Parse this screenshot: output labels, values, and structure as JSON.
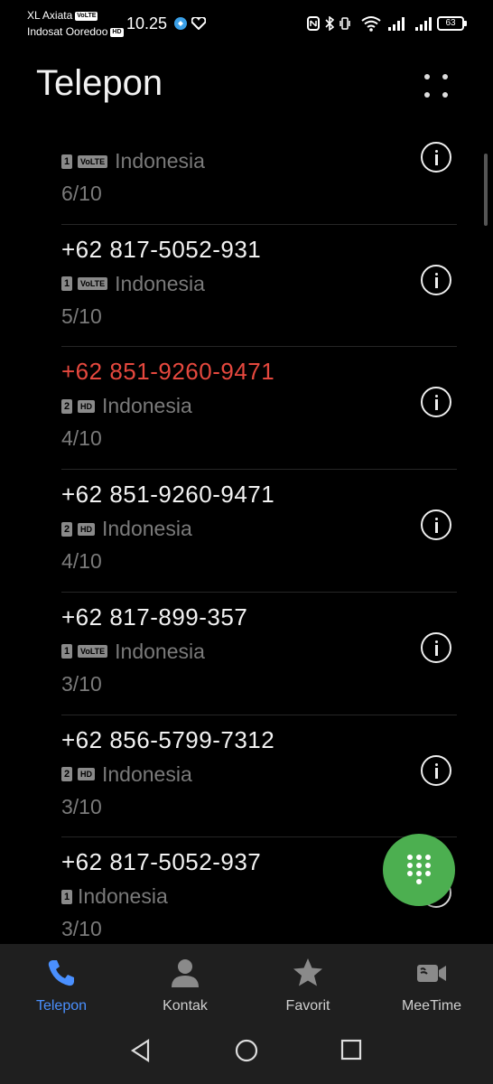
{
  "status_bar": {
    "carrier1": "XL Axiata",
    "carrier1_tag": "VoLTE",
    "carrier2": "Indosat Ooredoo",
    "carrier2_tag": "HD",
    "time": "10.25",
    "battery": "63"
  },
  "header": {
    "title": "Telepon"
  },
  "calls": [
    {
      "number": "",
      "sim": "1",
      "network": "VoLTE",
      "country": "Indonesia",
      "date": "6/10",
      "missed": false
    },
    {
      "number": "+62 817-5052-931",
      "sim": "1",
      "network": "VoLTE",
      "country": "Indonesia",
      "date": "5/10",
      "missed": false
    },
    {
      "number": "+62 851-9260-9471",
      "sim": "2",
      "network": "HD",
      "country": "Indonesia",
      "date": "4/10",
      "missed": true
    },
    {
      "number": "+62 851-9260-9471",
      "sim": "2",
      "network": "HD",
      "country": "Indonesia",
      "date": "4/10",
      "missed": false
    },
    {
      "number": "+62 817-899-357",
      "sim": "1",
      "network": "VoLTE",
      "country": "Indonesia",
      "date": "3/10",
      "missed": false
    },
    {
      "number": "+62 856-5799-7312",
      "sim": "2",
      "network": "HD",
      "country": "Indonesia",
      "date": "3/10",
      "missed": false
    },
    {
      "number": "+62 817-5052-937",
      "sim": "1",
      "network": "",
      "country": "Indonesia",
      "date": "3/10",
      "missed": false
    }
  ],
  "bottom_nav": {
    "items": [
      {
        "label": "Telepon",
        "icon": "phone-icon",
        "active": true
      },
      {
        "label": "Kontak",
        "icon": "contacts-icon",
        "active": false
      },
      {
        "label": "Favorit",
        "icon": "star-icon",
        "active": false
      },
      {
        "label": "MeeTime",
        "icon": "video-call-icon",
        "active": false
      }
    ]
  },
  "colors": {
    "missed": "#e5483e",
    "accent": "#4a90ff",
    "fab": "#4caf50"
  }
}
